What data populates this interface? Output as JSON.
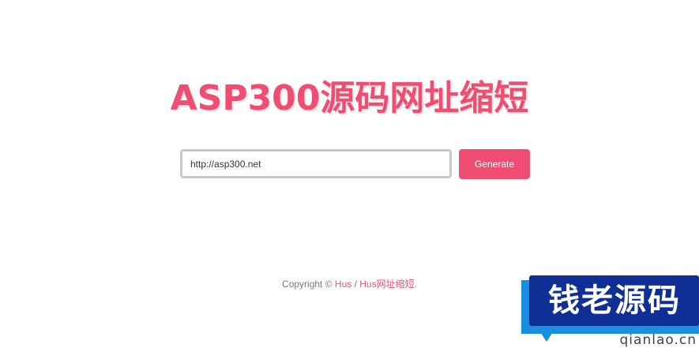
{
  "header": {
    "title": "ASP300源码网址缩短"
  },
  "form": {
    "url_value": "http://asp300.net",
    "generate_label": "Generate"
  },
  "footer": {
    "prefix": "Copyright © ",
    "link1": "Hus",
    "separator": " / ",
    "link2": "Hus网址缩短",
    "suffix": "."
  },
  "watermark": {
    "text": "钱老源码",
    "sub": "qianlao.cn"
  },
  "colors": {
    "accent": "#ef4d72",
    "watermark_dark": "#0f2f95",
    "watermark_light": "#1a8fe0"
  }
}
